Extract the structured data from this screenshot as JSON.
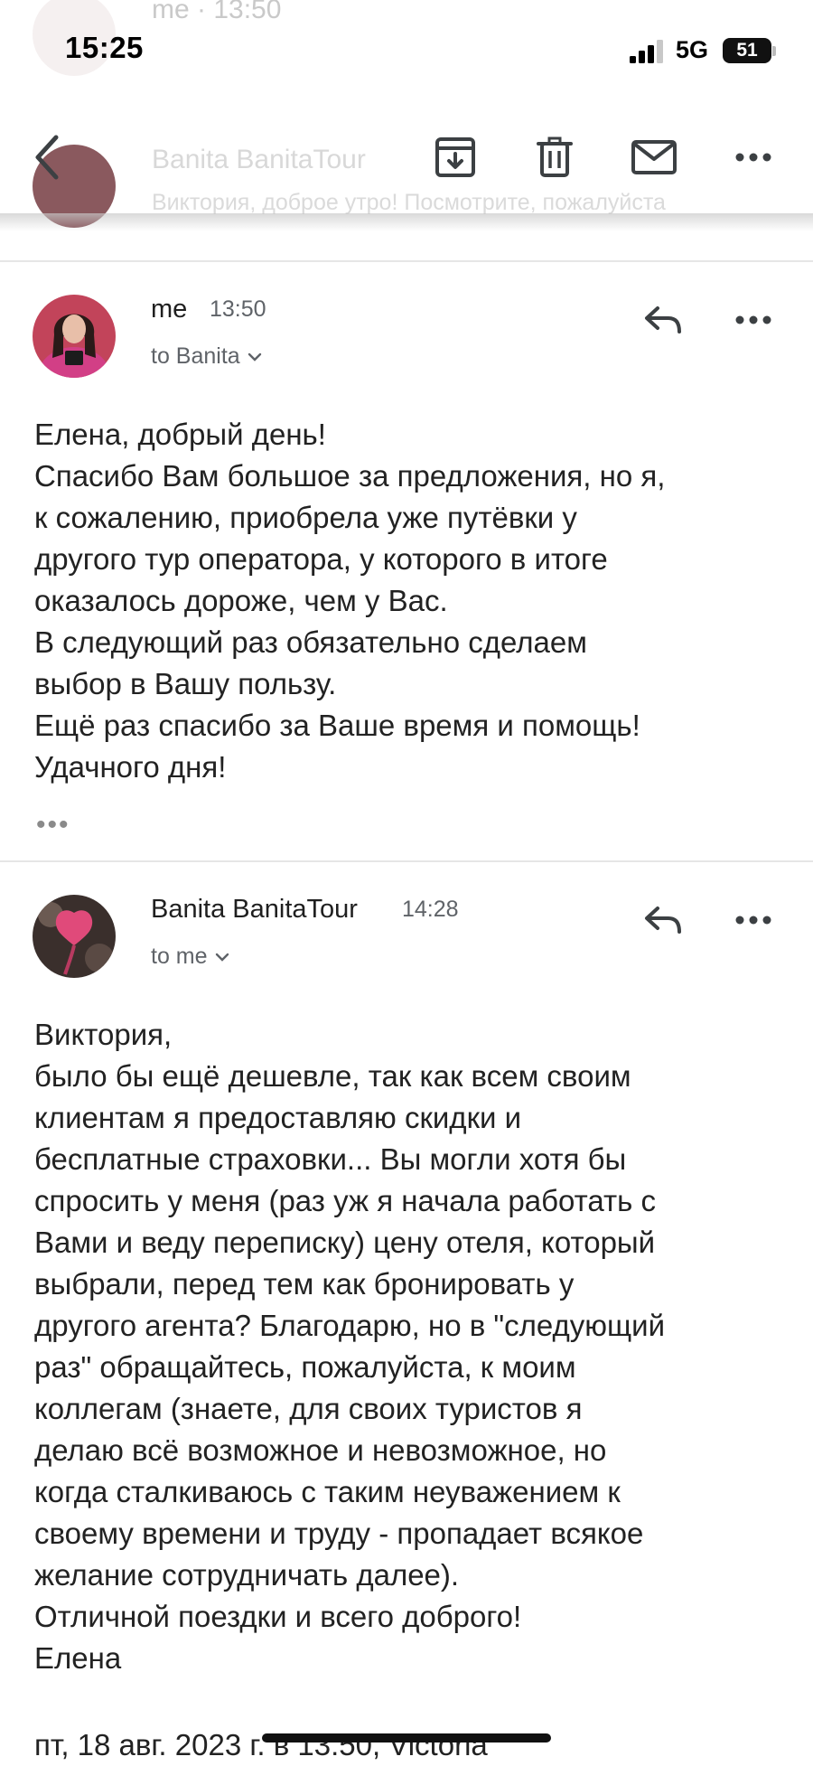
{
  "status_bar": {
    "time": "15:25",
    "network": "5G",
    "battery": "51"
  },
  "background_peek": {
    "sender_1": "me · 13:50",
    "sender_2": "Banita BanitaTour",
    "snippet": "Виктория, доброе утро! Посмотрите, пожалуйста"
  },
  "toolbar": {
    "icons": [
      "back-icon",
      "archive-icon",
      "delete-icon",
      "mark-unread-icon",
      "more-icon"
    ]
  },
  "messages": [
    {
      "sender": "me",
      "time": "13:50",
      "recipient": "to Banita",
      "avatar": "avatar-photo-woman",
      "body_lines": [
        "Елена, добрый день!",
        "Спасибо Вам большое за предложения, но я,",
        "к сожалению, приобрела уже путёвки у",
        "другого тур оператора, у которого в итоге",
        "оказалось дороже, чем у Вас.",
        "В следующий раз обязательно сделаем",
        "выбор в Вашу пользу.",
        "Ещё раз спасибо за Ваше время и помощь!",
        "Удачного дня!"
      ],
      "trimmed": "•••"
    },
    {
      "sender": "Banita BanitaTour",
      "time": "14:28",
      "recipient": "to me",
      "avatar": "avatar-pink-flower",
      "body_lines": [
        "Виктория,",
        "было бы ещё дешевле, так как всем своим",
        "клиентам я предоставляю скидки и",
        "бесплатные страховки... Вы могли хотя бы",
        "спросить у меня (раз уж я начала работать с",
        "Вами и веду переписку) цену отеля, который",
        "выбрали, перед тем как бронировать у",
        "другого агента? Благодарю, но в \"следующий",
        "раз\" обращайтесь, пожалуйста, к моим",
        "коллегам (знаете, для своих туристов я",
        "делаю всё возможное и невозможное, но",
        "когда сталкиваюсь с таким неуважением к",
        "своему времени и труду - пропадает всякое",
        "желание сотрудничать далее).",
        "Отличной поездки и всего доброго!",
        "Елена"
      ],
      "quoted_header": "пт, 18 авг. 2023 г. в 13:50, Victoria"
    }
  ]
}
